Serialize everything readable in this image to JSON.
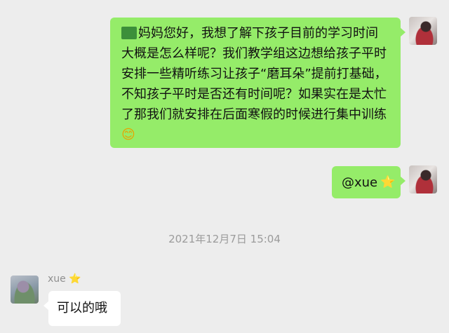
{
  "messages": {
    "outgoing_1": {
      "lines": [
        "妈妈您好，我想了解下孩子目前的学习时间",
        "大概是怎么样呢？我们教学组这边想给孩子平时",
        "安排一些精听练习让孩子“磨耳朵”提前打基础，",
        "不知孩子平时是否还有时间呢？如果实在是太忙",
        "了那我们就安排在后面寒假的时候进行集中训练"
      ],
      "emoji": "😊"
    },
    "outgoing_2": {
      "text": "@xue",
      "emoji": "⭐"
    },
    "timestamp": "2021年12月7日 15:04",
    "incoming_1": {
      "sender": "xue",
      "sender_emoji": "⭐",
      "text": "可以的哦"
    }
  },
  "icons": {
    "my_avatar": "avatar-photo",
    "xue_avatar": "avatar-photo",
    "smile": "smile-emoji-icon",
    "star": "star-emoji-icon"
  },
  "colors": {
    "background": "#ededed",
    "outgoing_bubble": "#95ec69",
    "incoming_bubble": "#ffffff",
    "timestamp_text": "#9b9b9b"
  }
}
